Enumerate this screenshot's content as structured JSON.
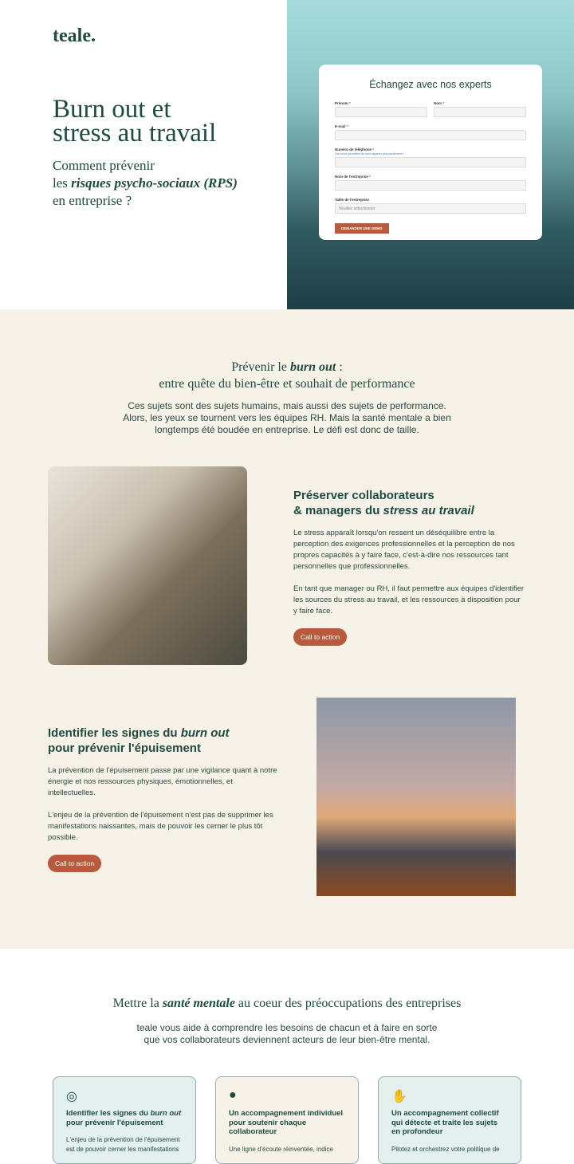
{
  "hero": {
    "logo": "teale.",
    "title_l1": "Burn out et",
    "title_l2": "stress au travail",
    "sub_l1": "Comment prévenir",
    "sub_l2a": "les ",
    "sub_l2b": "risques psycho-sociaux (RPS)",
    "sub_l3": "en entreprise ?"
  },
  "form": {
    "title": "Échangez avec nos experts",
    "firstname": "Prénom",
    "lastname": "Nom",
    "email": "E-mail",
    "phone": "Numéro de téléphone",
    "phone_hint": "Cela nous permettra de vous rappeler plus rapidement !",
    "company": "Nom de l'entreprise",
    "size": "Taille de l'entreprise",
    "size_placeholder": "Veuillez sélectionner",
    "submit": "DEMANDER UNE DÉMO",
    "required": "*"
  },
  "section2": {
    "title_a": "Prévenir le ",
    "title_b": "burn out",
    "title_c": " :",
    "title_l2": "entre quête du bien-être et souhait de performance",
    "p1": "Ces sujets sont des sujets humains, mais aussi des sujets de performance.",
    "p2": "Alors, les yeux se tournent vers les équipes RH. Mais la santé mentale a bien",
    "p3": "longtemps été boudée en entreprise. Le défi est donc de taille."
  },
  "block1": {
    "t1": "Préserver collaborateurs",
    "t2a": "& managers du ",
    "t2b": "stress au travail",
    "p1": "Le stress apparaît lorsqu'on ressent un déséquilibre entre la perception des exigences professionnelles et la perception de nos propres capacités à y faire face, c'est-à-dire nos ressources tant personnelles que professionnelles.",
    "p2": "En tant que manager ou RH, il faut permettre aux équipes d'identifier les sources du stress au travail, et les ressources à disposition pour y faire face.",
    "cta": "Call to action"
  },
  "block2": {
    "t1a": "Identifier les signes du ",
    "t1b": "burn out",
    "t2": "pour prévenir l'épuisement",
    "p1": "La prévention de l'épuisement passe par une vigilance quant à notre énergie et nos ressources physiques, émotionnelles, et intellectuelles.",
    "p2": "L'enjeu de la prévention de l'épuisement n'est pas de supprimer les manifestations naissantes, mais de pouvoir les cerner le plus tôt possible.",
    "cta": "Call to action"
  },
  "section3": {
    "title_a": "Mettre la ",
    "title_b": "santé mentale",
    "title_c": " au coeur des préoccupations des entreprises",
    "p1": "teale vous aide à comprendre les besoins de chacun et à faire en sorte",
    "p2": "que vos collaborateurs deviennent acteurs de leur bien-être mental."
  },
  "cards": [
    {
      "icon": "target-icon",
      "title_a": "Identifier les signes du ",
      "title_b": "burn out",
      "title_c": " pour prévenir l'épuisement",
      "text": "L'enjeu de la prévention de l'épuisement est de pouvoir cerner les manifestations",
      "bg": "#e3f0ed"
    },
    {
      "icon": "user-icon",
      "title_a": "Un accompagnement individuel pour soutenir chaque collaborateur",
      "title_b": "",
      "title_c": "",
      "text": "Une ligne d'écoute réinventée, indice",
      "bg": "#f7f2e7"
    },
    {
      "icon": "handshake-icon",
      "title_a": "Un accompagnement collectif qui détecte et traite les sujets en profondeur",
      "title_b": "",
      "title_c": "",
      "text": "Pilotez et orchestrez votre politique de",
      "bg": "#e3f0ed"
    }
  ]
}
